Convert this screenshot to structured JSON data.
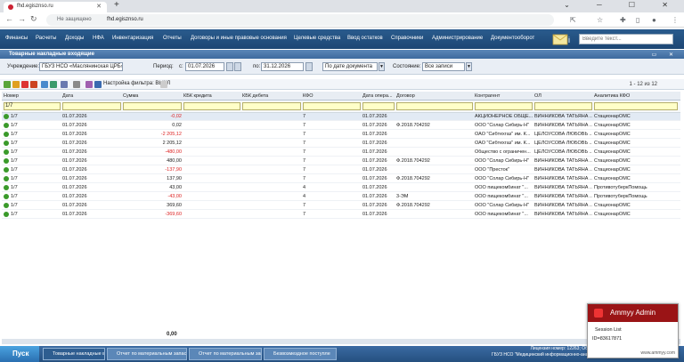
{
  "browser": {
    "tab_title": "fhd.egisznso.ru",
    "address_security": "Не защищено",
    "address_url": "fhd.egisznso.ru"
  },
  "menu": [
    "Финансы",
    "Расчеты",
    "Доходы",
    "НФА",
    "Инвентаризация",
    "Отчеты",
    "Договоры и иные правовые основания",
    "Целевые средства",
    "Ввод остатков",
    "Справочники",
    "Администрирование",
    "Документооборот"
  ],
  "search": {
    "placeholder": "Введите текст..."
  },
  "window": {
    "title": "Товарные накладные входящие"
  },
  "filters": {
    "institution_label": "Учреждение:",
    "institution": "ГБУЗ НСО «Маслянинская ЦРБ»",
    "period_label": "Период:",
    "from_label": "с:",
    "date_from": "01.07.2026",
    "to_label": "по:",
    "date_to": "31.12.2026",
    "date_mode": "По дате документа",
    "state_label": "Состояние:",
    "state": "Все записи"
  },
  "toolbar": {
    "filter_settings": "Настройка фильтра: ВЫКЛ",
    "pager": "1 - 12 из 12"
  },
  "grid": {
    "columns": [
      "Номер",
      "Дата",
      "Сумма",
      "КБК кредита",
      "КБК дебета",
      "КФО",
      "Дата опера...",
      "Договор",
      "Контрагент",
      "ОЛ",
      "Аналитика КФО"
    ],
    "filter_number": "1/7",
    "rows": [
      {
        "num": "1/7",
        "date": "01.07.2026",
        "sum": "-0,02",
        "neg": true,
        "kfo": "7",
        "opdate": "01.07.2026",
        "contract": "",
        "agent": "АКЦИОНЕРНОЕ ОБЩЕ...",
        "ol": "ВИННИКОВА ТАТЬЯНА ...",
        "an": "СтационарОМС"
      },
      {
        "num": "1/7",
        "date": "01.07.2026",
        "sum": "0,02",
        "neg": false,
        "kfo": "7",
        "opdate": "01.07.2026",
        "contract": "Ф.2018.704292",
        "agent": "ООО \"Солар Сибирь-Н\"",
        "ol": "ВИННИКОВА ТАТЬЯНА ...",
        "an": "СтационарОМС"
      },
      {
        "num": "1/7",
        "date": "01.07.2026",
        "sum": "-2 205,12",
        "neg": true,
        "kfo": "7",
        "opdate": "01.07.2026",
        "contract": "",
        "agent": "ОАО \"Сибтехгаз\" им. К...",
        "ol": "ЦЕЛОУСОВА ЛЮБОВЬ ...",
        "an": "СтационарОМС"
      },
      {
        "num": "1/7",
        "date": "01.07.2026",
        "sum": "2 205,12",
        "neg": false,
        "kfo": "7",
        "opdate": "01.07.2026",
        "contract": "",
        "agent": "ОАО \"Сибтехгаз\" им. К...",
        "ol": "ЦЕЛОУСОВА ЛЮБОВЬ ...",
        "an": "СтационарОМС"
      },
      {
        "num": "1/7",
        "date": "01.07.2026",
        "sum": "-480,00",
        "neg": true,
        "kfo": "7",
        "opdate": "01.07.2026",
        "contract": "",
        "agent": "Общество с ограничен...",
        "ol": "ЦЕЛОУСОВА ЛЮБОВЬ ...",
        "an": "СтационарОМС"
      },
      {
        "num": "1/7",
        "date": "01.07.2026",
        "sum": "480,00",
        "neg": false,
        "kfo": "7",
        "opdate": "01.07.2026",
        "contract": "Ф.2018.704292",
        "agent": "ООО \"Солар Сибирь-Н\"",
        "ol": "ВИННИКОВА ТАТЬЯНА ...",
        "an": "СтационарОМС"
      },
      {
        "num": "1/7",
        "date": "01.07.2026",
        "sum": "-137,90",
        "neg": true,
        "kfo": "7",
        "opdate": "01.07.2026",
        "contract": "",
        "agent": "ООО \"Престок\"",
        "ol": "ВИННИКОВА ТАТЬЯНА ...",
        "an": "СтационарОМС"
      },
      {
        "num": "1/7",
        "date": "01.07.2026",
        "sum": "137,90",
        "neg": false,
        "kfo": "7",
        "opdate": "01.07.2026",
        "contract": "Ф.2018.704292",
        "agent": "ООО \"Солар Сибирь-Н\"",
        "ol": "ВИННИКОВА ТАТЬЯНА ...",
        "an": "СтационарОМС"
      },
      {
        "num": "1/7",
        "date": "01.07.2026",
        "sum": "43,00",
        "neg": false,
        "kfo": "4",
        "opdate": "01.07.2026",
        "contract": "",
        "agent": "ООО пищекомбинат \"...",
        "ol": "ВИННИКОВА ТАТЬЯНА ...",
        "an": "ПротивотуберкПомощь"
      },
      {
        "num": "1/7",
        "date": "01.07.2026",
        "sum": "-43,00",
        "neg": true,
        "kfo": "4",
        "opdate": "01.07.2026",
        "contract": "3-ЭМ",
        "agent": "ООО пищекомбинат \"...",
        "ol": "ВИННИКОВА ТАТЬЯНА ...",
        "an": "ПротивотуберкПомощь"
      },
      {
        "num": "1/7",
        "date": "01.07.2026",
        "sum": "369,60",
        "neg": false,
        "kfo": "7",
        "opdate": "01.07.2026",
        "contract": "Ф.2018.704292",
        "agent": "ООО \"Солар Сибирь-Н\"",
        "ol": "ВИННИКОВА ТАТЬЯНА ...",
        "an": "СтационарОМС"
      },
      {
        "num": "1/7",
        "date": "01.07.2026",
        "sum": "-369,60",
        "neg": true,
        "kfo": "7",
        "opdate": "01.07.2026",
        "contract": "",
        "agent": "ООО пищекомбинат \"...",
        "ol": "ВИННИКОВА ТАТЬЯНА ...",
        "an": "СтационарОМС"
      }
    ],
    "total": "0,00"
  },
  "taskbar": {
    "start": "Пуск",
    "tasks": [
      "Товарные накладные вхо",
      "Отчет по материальным запасам",
      "Отчет по материальным запа",
      "Безвозмездное поступле"
    ],
    "license": "Лицензия номер: 12263; Об",
    "org": "ГБУЗ НСО \"Медицинский информационно-анали"
  },
  "ammyy": {
    "title": "Ammyy Admin",
    "session_list": "Session List",
    "id": "ID=83617871",
    "site": "www.ammyy.com"
  }
}
